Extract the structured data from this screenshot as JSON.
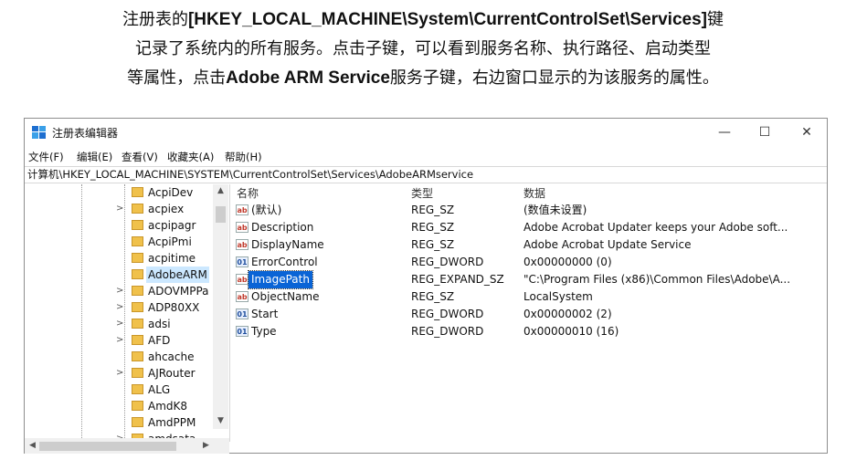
{
  "caption": {
    "line1_pre": "注册表的",
    "line1_bold": "[HKEY_LOCAL_MACHINE\\System\\CurrentControlSet\\Services]",
    "line1_post": "键",
    "line2": "记录了系统内的所有服务。点击子键，可以看到服务名称、执行路径、启动类型",
    "line3_pre": "等属性，点击",
    "line3_bold": "Adobe ARM Service",
    "line3_post": "服务子键，右边窗口显示的为该服务的属性。"
  },
  "window": {
    "title": "注册表编辑器",
    "minimize": "—",
    "maximize": "☐",
    "close": "✕",
    "icon": "regedit-icon"
  },
  "menu": [
    "文件(F)",
    "编辑(E)",
    "查看(V)",
    "收藏夹(A)",
    "帮助(H)"
  ],
  "address": "计算机\\HKEY_LOCAL_MACHINE\\SYSTEM\\CurrentControlSet\\Services\\AdobeARMservice",
  "tree": [
    {
      "label": "AcpiDev",
      "expander": ""
    },
    {
      "label": "acpiex",
      "expander": ">"
    },
    {
      "label": "acpipagr",
      "expander": ""
    },
    {
      "label": "AcpiPmi",
      "expander": ""
    },
    {
      "label": "acpitime",
      "expander": ""
    },
    {
      "label": "AdobeARM",
      "expander": "",
      "selected": true
    },
    {
      "label": "ADOVMPPa",
      "expander": ">"
    },
    {
      "label": "ADP80XX",
      "expander": ">"
    },
    {
      "label": "adsi",
      "expander": ">"
    },
    {
      "label": "AFD",
      "expander": ">"
    },
    {
      "label": "ahcache",
      "expander": ""
    },
    {
      "label": "AJRouter",
      "expander": ">"
    },
    {
      "label": "ALG",
      "expander": ""
    },
    {
      "label": "AmdK8",
      "expander": ""
    },
    {
      "label": "AmdPPM",
      "expander": ""
    },
    {
      "label": "amdsata",
      "expander": ">"
    }
  ],
  "columns": {
    "name": "名称",
    "type": "类型",
    "data": "数据"
  },
  "values": [
    {
      "icon": "ab",
      "name": "(默认)",
      "type": "REG_SZ",
      "data": "(数值未设置)"
    },
    {
      "icon": "ab",
      "name": "Description",
      "type": "REG_SZ",
      "data": "Adobe Acrobat Updater keeps your Adobe soft..."
    },
    {
      "icon": "ab",
      "name": "DisplayName",
      "type": "REG_SZ",
      "data": "Adobe Acrobat Update Service"
    },
    {
      "icon": "bin",
      "name": "ErrorControl",
      "type": "REG_DWORD",
      "data": "0x00000000 (0)"
    },
    {
      "icon": "ab",
      "name": "ImagePath",
      "type": "REG_EXPAND_SZ",
      "data": "\"C:\\Program Files (x86)\\Common Files\\Adobe\\A...",
      "selected": true
    },
    {
      "icon": "ab",
      "name": "ObjectName",
      "type": "REG_SZ",
      "data": "LocalSystem"
    },
    {
      "icon": "bin",
      "name": "Start",
      "type": "REG_DWORD",
      "data": "0x00000002 (2)"
    },
    {
      "icon": "bin",
      "name": "Type",
      "type": "REG_DWORD",
      "data": "0x00000010 (16)"
    }
  ]
}
